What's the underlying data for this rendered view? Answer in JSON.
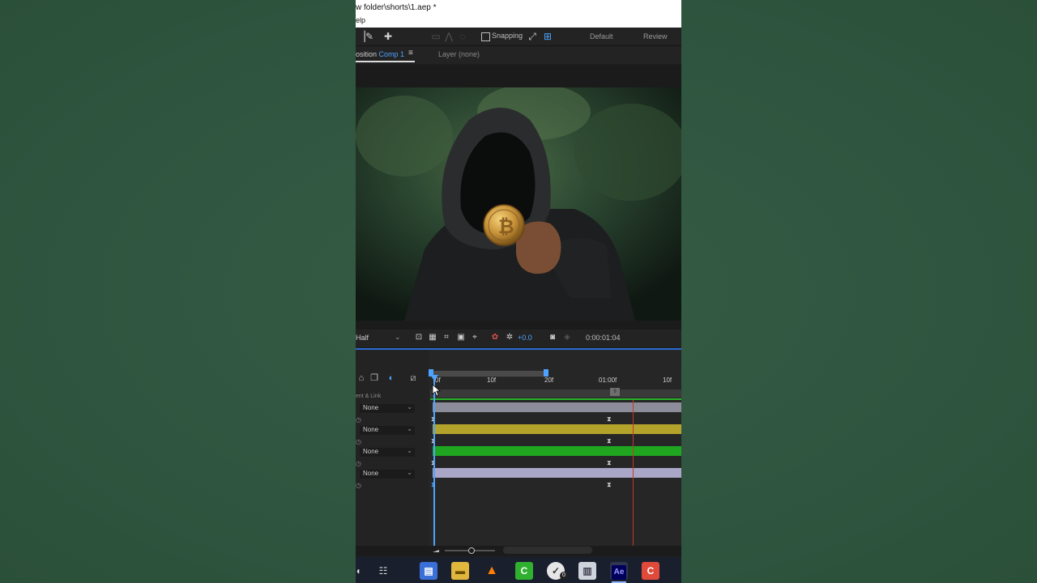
{
  "window": {
    "title_line1": "w folder\\shorts\\1.aep *",
    "title_line2": "elp"
  },
  "toolbar": {
    "snapping_label": "Snapping",
    "workspace_default": "Default",
    "workspace_review": "Review"
  },
  "panel": {
    "comp_tab_prefix": "osition",
    "comp_tab_name": "Comp 1",
    "menu_glyph": "≡",
    "layer_tab": "Layer (none)"
  },
  "viewer": {
    "resolution": "Half",
    "exposure": "+0.0",
    "current_time": "0:00:01:04"
  },
  "timeline": {
    "column_parent": "ent & Link",
    "ticks": [
      "0f",
      "10f",
      "20f",
      "01:00f",
      "10f"
    ],
    "end_marker": "9",
    "layers": [
      {
        "parent": "None",
        "color": "#8c8c9a"
      },
      {
        "parent": "None",
        "color": "#b3a32a"
      },
      {
        "parent": "None",
        "color": "#1fa51f"
      },
      {
        "parent": "None",
        "color": "#aaa6c8"
      }
    ]
  },
  "taskbar": {
    "apps": [
      "windows-icon",
      "task-view-icon",
      "browser-icon",
      "file-explorer-icon",
      "vlc-icon",
      "camtasia-green-icon",
      "app-badge-icon",
      "notes-icon",
      "after-effects-icon",
      "camtasia-red-icon"
    ],
    "ae_label": "Ae",
    "badge_count": "0"
  },
  "colors": {
    "accent_blue": "#4da3ff",
    "ae_purple": "#9999ff",
    "background_green": "#2f5540"
  }
}
